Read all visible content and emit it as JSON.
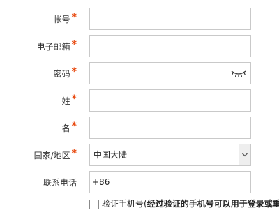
{
  "form": {
    "account": {
      "label": "帐号",
      "required_mark": "*"
    },
    "email": {
      "label": "电子邮箱",
      "required_mark": "*"
    },
    "password": {
      "label": "密码",
      "required_mark": "*"
    },
    "surname": {
      "label": "姓",
      "required_mark": "*"
    },
    "given_name": {
      "label": "名",
      "required_mark": "*"
    },
    "region": {
      "label": "国家/地区",
      "required_mark": "*",
      "selected_value": "中国大陆"
    },
    "phone": {
      "label": "联系电话",
      "country_code": "+86"
    },
    "verify": {
      "prefix": "验证手机号(",
      "bold_text": "经过验证的手机号可以用于登录或重置"
    }
  },
  "icons": {
    "password_toggle": "eye-closed-icon",
    "select_arrow": "chevron-down-icon"
  },
  "colors": {
    "required": "#e8490f",
    "border": "#c9c9c9"
  }
}
